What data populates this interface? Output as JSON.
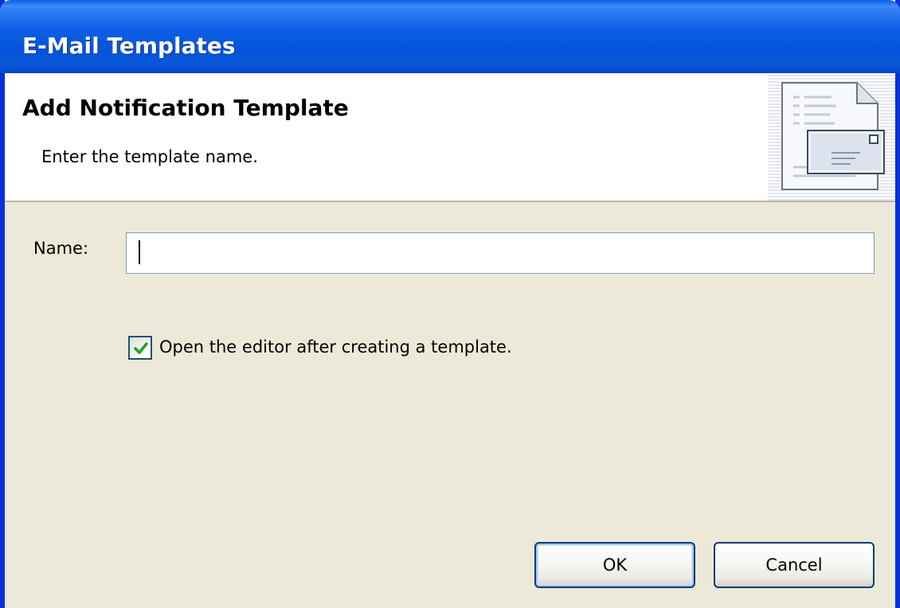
{
  "window": {
    "title": "E-Mail Templates"
  },
  "banner": {
    "heading": "Add Notification Template",
    "description": "Enter the template name.",
    "icon": "email-template-icon"
  },
  "form": {
    "name_label": "Name:",
    "name_value": "",
    "open_editor_label": "Open the editor after creating a template.",
    "open_editor_checked": true
  },
  "buttons": {
    "ok_label": "OK",
    "cancel_label": "Cancel"
  },
  "colors": {
    "titlebar": "#0a5fe6",
    "dialog_background": "#ece9d8",
    "checkmark": "#21a121",
    "button_border": "#003c74"
  }
}
